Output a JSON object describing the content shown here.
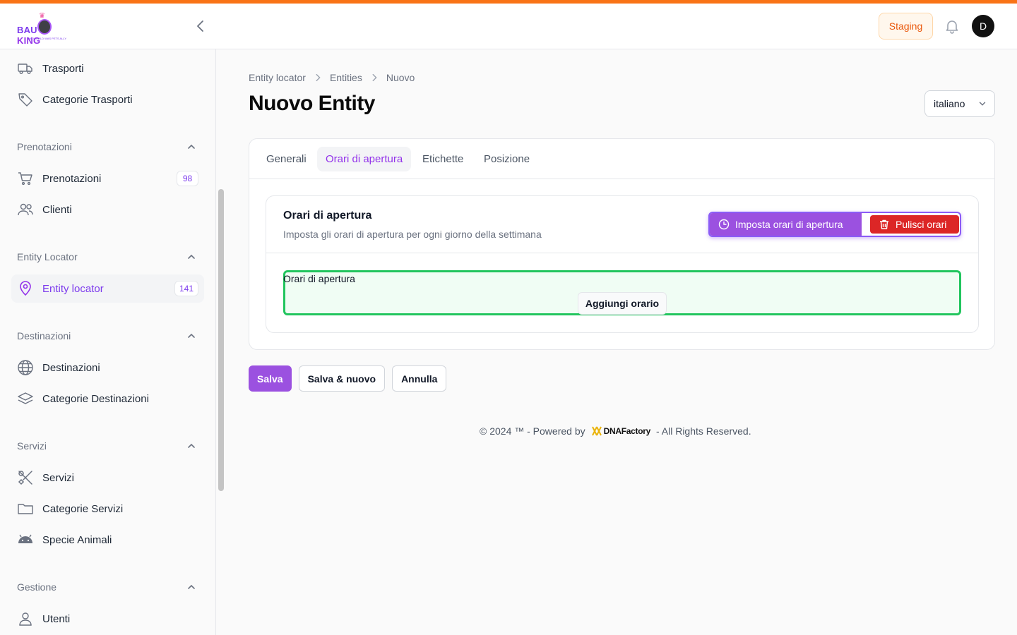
{
  "brand": {
    "logo_text_a": "BAU",
    "logo_text_b": "KING",
    "logo_tagline": "THE WORLD WAS PETS ALLY",
    "accent": "#f97316",
    "primary": "#9b51e0"
  },
  "header": {
    "env_badge": "Staging",
    "avatar_initial": "D"
  },
  "sidebar": {
    "items_top": [
      {
        "label": "Trasporti",
        "icon": "truck-icon"
      },
      {
        "label": "Categorie Trasporti",
        "icon": "tag-icon"
      }
    ],
    "groups": [
      {
        "label": "Prenotazioni",
        "items": [
          {
            "label": "Prenotazioni",
            "icon": "cart-icon",
            "count": "98"
          },
          {
            "label": "Clienti",
            "icon": "users-icon"
          }
        ]
      },
      {
        "label": "Entity Locator",
        "items": [
          {
            "label": "Entity locator",
            "icon": "map-pin-icon",
            "count": "141",
            "active": true
          }
        ]
      },
      {
        "label": "Destinazioni",
        "items": [
          {
            "label": "Destinazioni",
            "icon": "globe-icon"
          },
          {
            "label": "Categorie Destinazioni",
            "icon": "layers-icon"
          }
        ]
      },
      {
        "label": "Servizi",
        "items": [
          {
            "label": "Servizi",
            "icon": "tools-icon"
          },
          {
            "label": "Categorie Servizi",
            "icon": "folder-icon"
          },
          {
            "label": "Specie Animali",
            "icon": "android-icon"
          }
        ]
      },
      {
        "label": "Gestione",
        "items": [
          {
            "label": "Utenti",
            "icon": "user-icon"
          }
        ]
      }
    ]
  },
  "breadcrumb": [
    "Entity locator",
    "Entities",
    "Nuovo"
  ],
  "page": {
    "title": "Nuovo Entity",
    "language": "italiano"
  },
  "tabs": [
    {
      "label": "Generali"
    },
    {
      "label": "Orari di apertura",
      "active": true
    },
    {
      "label": "Etichette"
    },
    {
      "label": "Posizione"
    }
  ],
  "section": {
    "title": "Orari di apertura",
    "subtitle": "Imposta gli orari di apertura per ogni giorno della settimana",
    "set_button": "Imposta orari di apertura",
    "clear_button": "Pulisci orari",
    "repeater_label": "Orari di apertura",
    "add_button": "Aggiungi orario"
  },
  "actions": {
    "save": "Salva",
    "save_new": "Salva & nuovo",
    "cancel": "Annulla"
  },
  "footer": {
    "prefix": "© 2024 ™ - Powered by",
    "company": "DNAFactory",
    "suffix": "- All Rights Reserved."
  }
}
